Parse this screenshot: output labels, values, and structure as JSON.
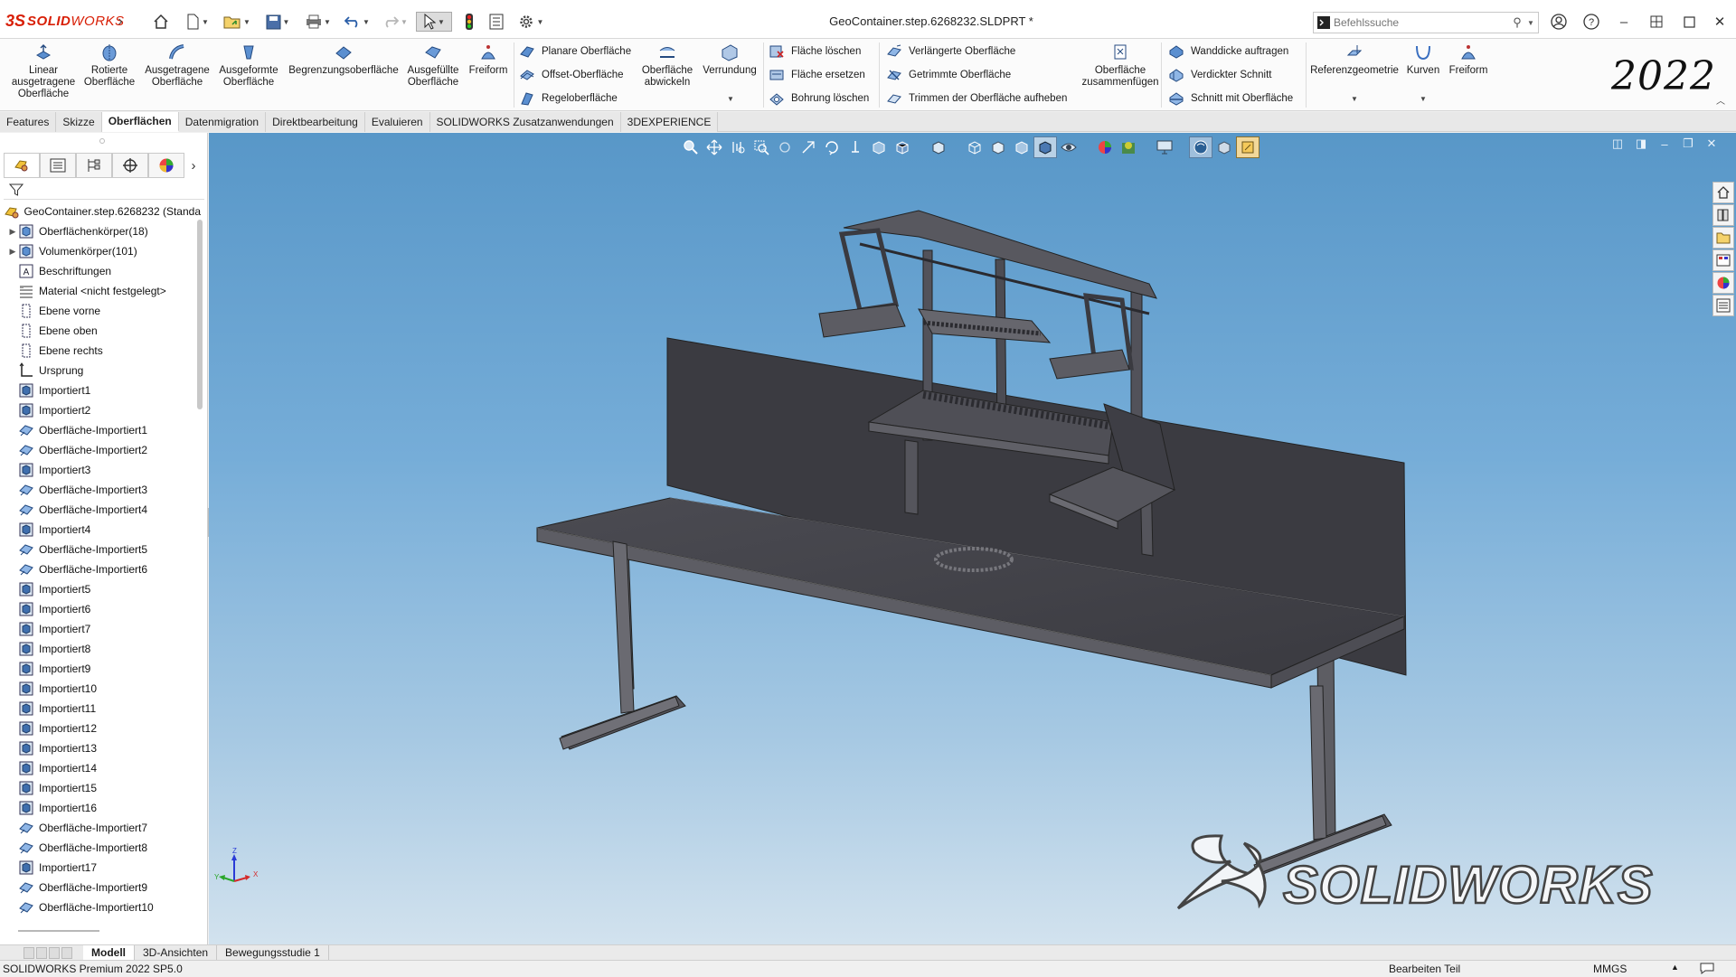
{
  "app": {
    "logo_prefix": "3S",
    "logo_bold": "SOLID",
    "logo_light": "WORKS",
    "title": "GeoContainer.step.6268232.SLDPRT *",
    "search_placeholder": "Befehlssuche",
    "year": "2022"
  },
  "ribbon": {
    "large": [
      {
        "label": "Linear ausgetragene Oberfläche"
      },
      {
        "label": "Rotierte Oberfläche"
      },
      {
        "label": "Ausgetragene Oberfläche"
      },
      {
        "label": "Ausgeformte Oberfläche"
      },
      {
        "label": "Begrenzungsoberfläche"
      },
      {
        "label": "Ausgefüllte Oberfläche"
      },
      {
        "label": "Freiform"
      },
      {
        "label": "Oberfläche abwickeln"
      },
      {
        "label": "Verrundung"
      },
      {
        "label": "Oberfläche zusammenfügen"
      },
      {
        "label": "Referenzgeometrie"
      },
      {
        "label": "Kurven"
      },
      {
        "label": "Freiform"
      }
    ],
    "group1": [
      "Planare Oberfläche",
      "Offset-Oberfläche",
      "Regeloberfläche"
    ],
    "group2": [
      "Fläche löschen",
      "Fläche ersetzen",
      "Bohrung löschen"
    ],
    "group3": [
      "Verlängerte Oberfläche",
      "Getrimmte Oberfläche",
      "Trimmen der Oberfläche aufheben"
    ],
    "group4": [
      "Wanddicke auftragen",
      "Verdickter Schnitt",
      "Schnitt mit Oberfläche"
    ]
  },
  "tabs": [
    "Features",
    "Skizze",
    "Oberflächen",
    "Datenmigration",
    "Direktbearbeitung",
    "Evaluieren",
    "SOLIDWORKS Zusatzanwendungen",
    "3DEXPERIENCE"
  ],
  "active_tab": "Oberflächen",
  "tree": {
    "root": "GeoContainer.step.6268232 (Standa",
    "items": [
      "Oberflächenkörper(18)",
      "Volumenkörper(101)",
      "Beschriftungen",
      "Material <nicht festgelegt>",
      "Ebene vorne",
      "Ebene oben",
      "Ebene rechts",
      "Ursprung",
      "Importiert1",
      "Importiert2",
      "Oberfläche-Importiert1",
      "Oberfläche-Importiert2",
      "Importiert3",
      "Oberfläche-Importiert3",
      "Oberfläche-Importiert4",
      "Importiert4",
      "Oberfläche-Importiert5",
      "Oberfläche-Importiert6",
      "Importiert5",
      "Importiert6",
      "Importiert7",
      "Importiert8",
      "Importiert9",
      "Importiert10",
      "Importiert11",
      "Importiert12",
      "Importiert13",
      "Importiert14",
      "Importiert15",
      "Importiert16",
      "Oberfläche-Importiert7",
      "Oberfläche-Importiert8",
      "Importiert17",
      "Oberfläche-Importiert9",
      "Oberfläche-Importiert10"
    ]
  },
  "bottom_tabs": [
    "Modell",
    "3D-Ansichten",
    "Bewegungsstudie 1"
  ],
  "status": {
    "left": "SOLIDWORKS Premium 2022 SP5.0",
    "mode": "Bearbeiten Teil",
    "units": "MMGS"
  },
  "watermark": "SOLIDWORKS",
  "triad": {
    "x": "X",
    "y": "Y",
    "z": "Z"
  },
  "colors": {
    "brand": "#d81e05",
    "viewport_top": "#5897c8",
    "viewport_bottom": "#d2e2ee",
    "model": "#3f3f45"
  }
}
